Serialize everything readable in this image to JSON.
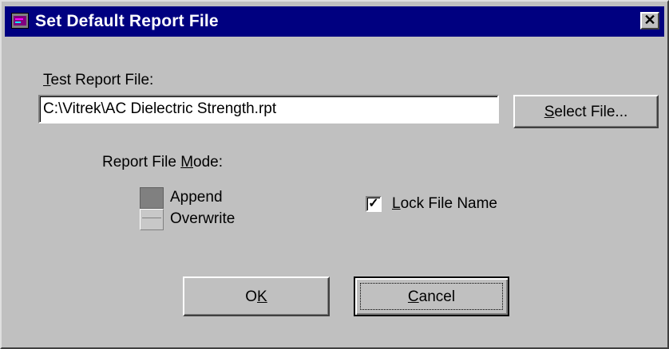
{
  "window": {
    "title": "Set Default Report File",
    "close_glyph": "✕",
    "icon": "app-icon"
  },
  "file": {
    "label_prefix": "",
    "label_underlined": "T",
    "label_rest": "est Report File:",
    "value": "C:\\Vitrek\\AC Dielectric Strength.rpt",
    "select_label_underlined": "S",
    "select_label_rest": "elect File..."
  },
  "mode": {
    "label_prefix": "Report File ",
    "label_underlined": "M",
    "label_rest": "ode:",
    "options": [
      "Append",
      "Overwrite"
    ],
    "selected": "Append"
  },
  "lock": {
    "checked": true,
    "check_glyph": "✓",
    "label_underlined": "L",
    "label_rest": "ock File Name"
  },
  "buttons": {
    "ok_prefix": "O",
    "ok_underlined": "K",
    "cancel_underlined": "C",
    "cancel_rest": "ancel"
  },
  "colors": {
    "titlebar": "#000080",
    "face": "#c0c0c0"
  }
}
